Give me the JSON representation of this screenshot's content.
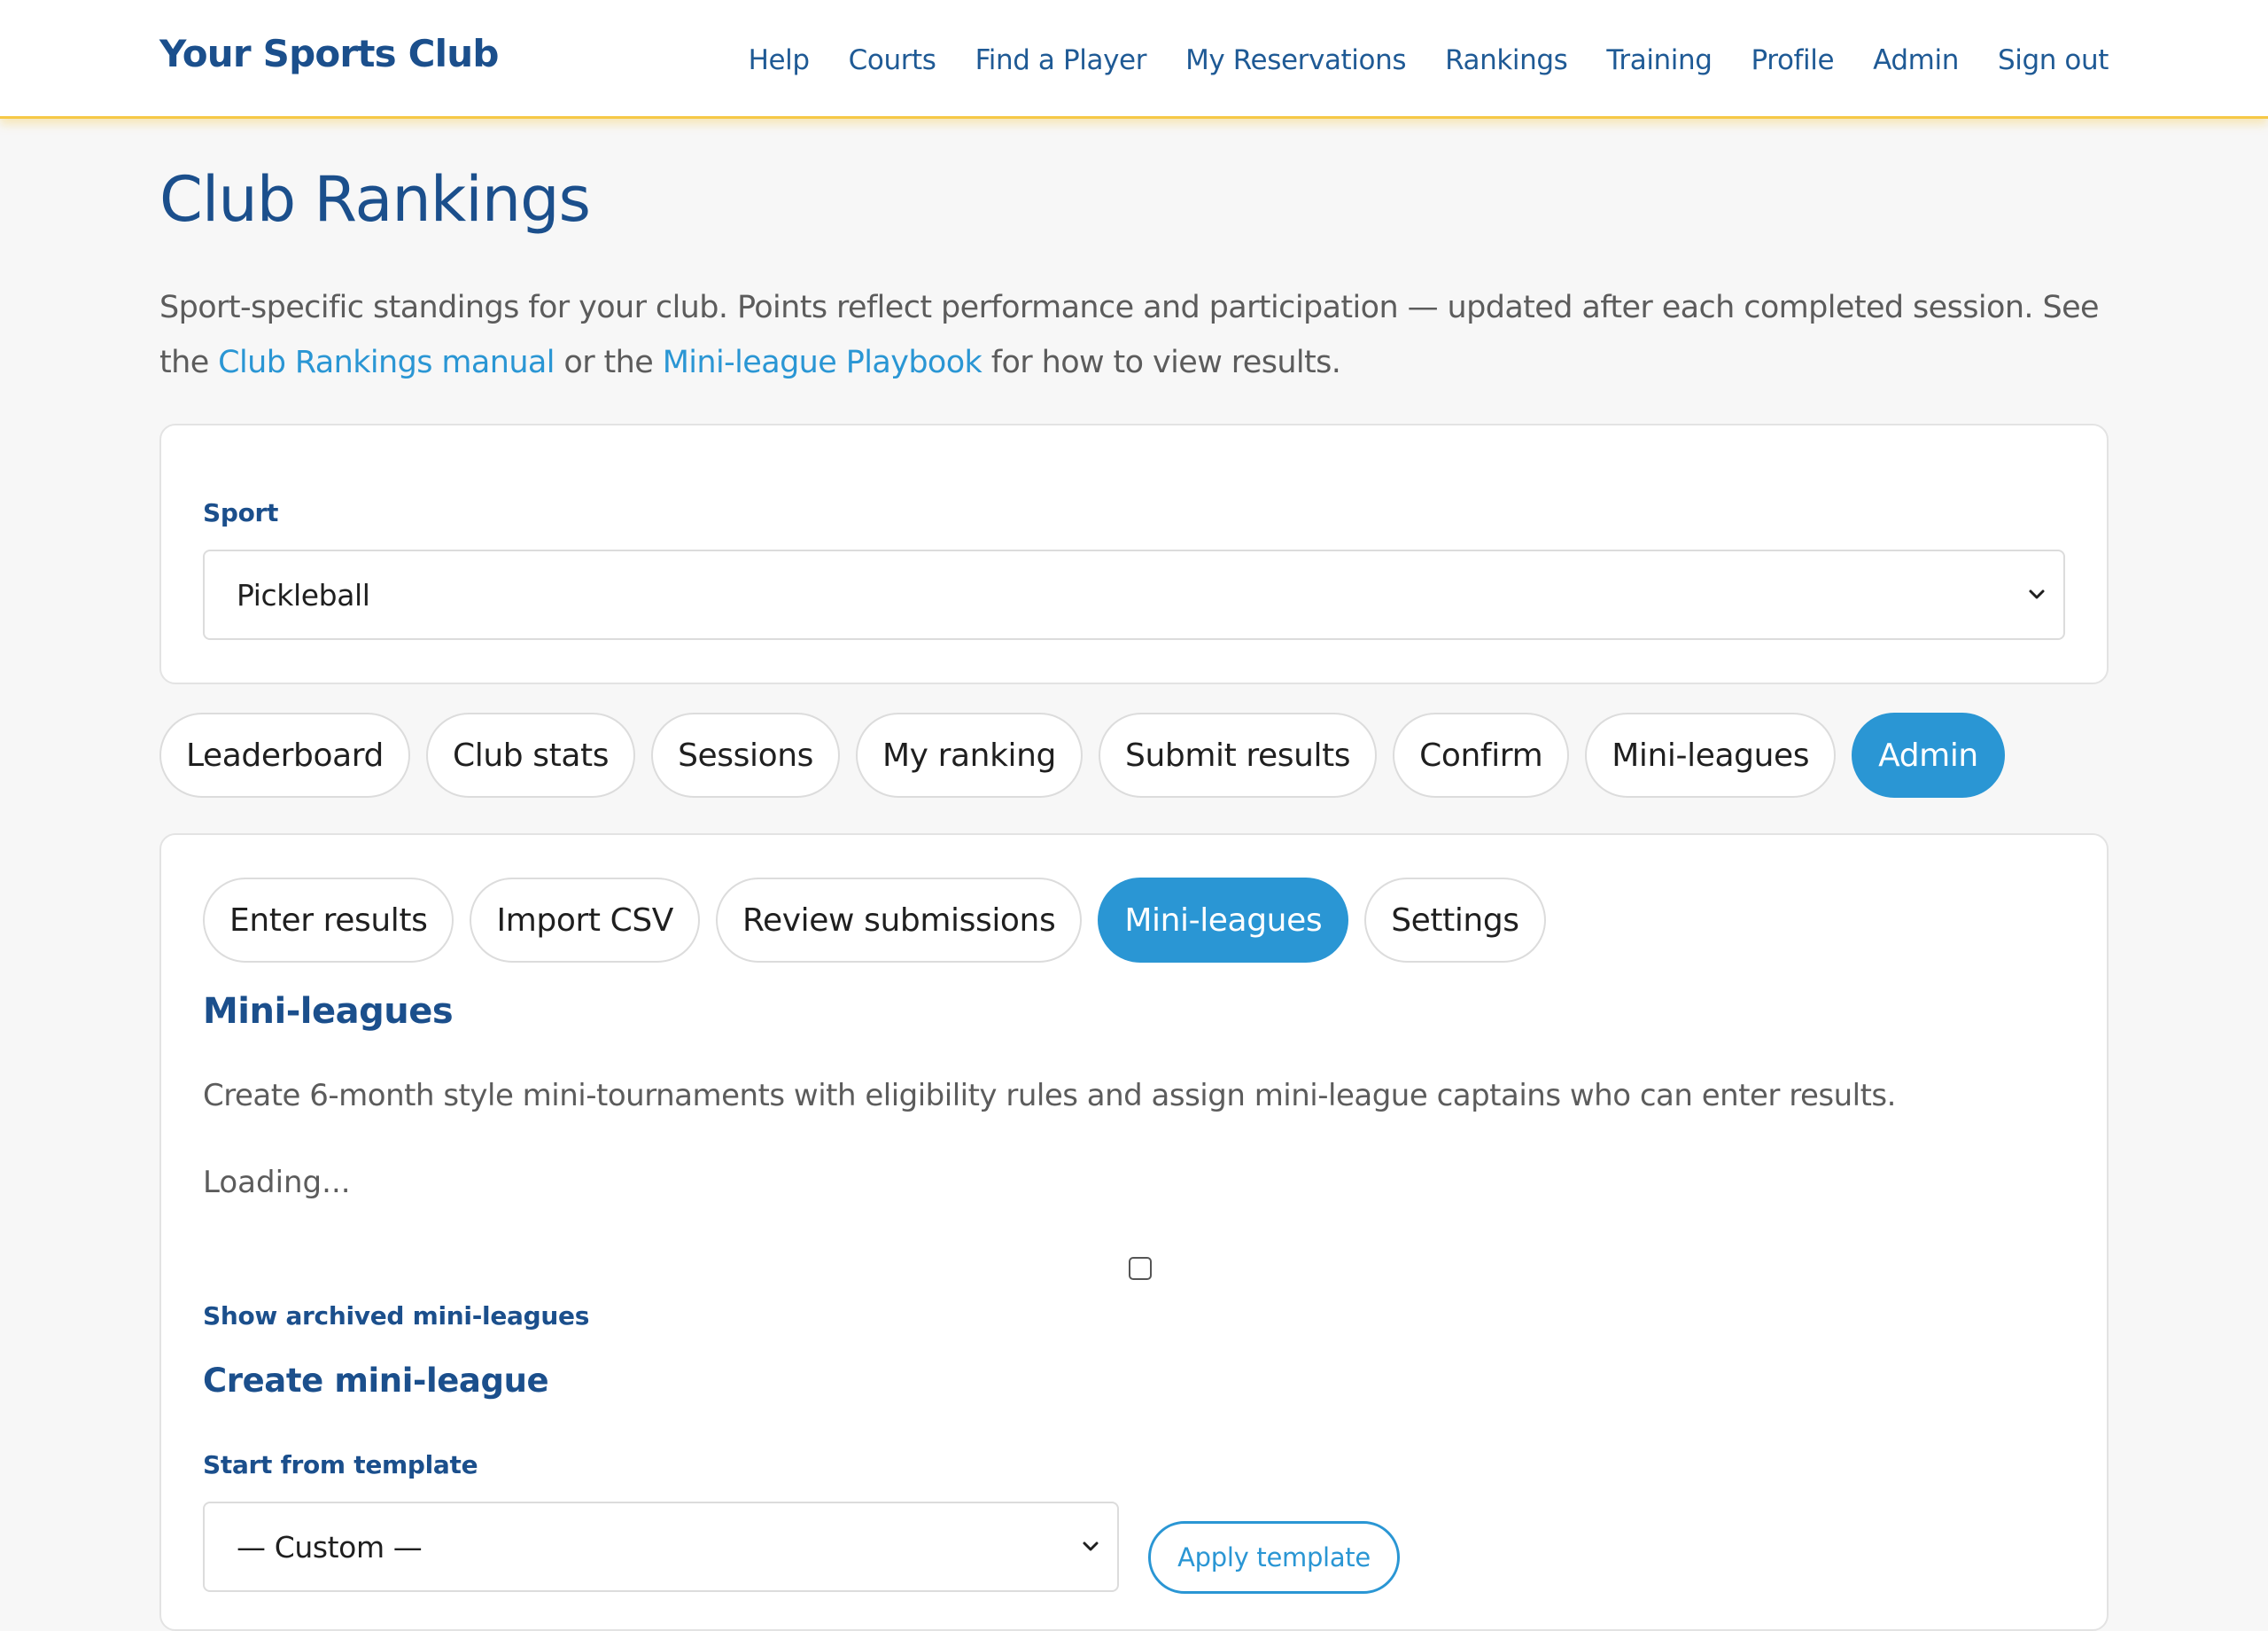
{
  "header": {
    "brand": "Your Sports Club",
    "nav": [
      "Help",
      "Courts",
      "Find a Player",
      "My Reservations",
      "Rankings",
      "Training",
      "Profile",
      "Admin",
      "Sign out"
    ]
  },
  "page": {
    "title": "Club Rankings",
    "intro_text_1": "Sport-specific standings for your club. Points reflect performance and participation — updated after each completed session. See the ",
    "intro_link_1": "Club Rankings manual",
    "intro_text_2": " or the ",
    "intro_link_2": "Mini-league Playbook",
    "intro_text_3": " for how to view results."
  },
  "sport": {
    "label": "Sport",
    "selected": "Pickleball"
  },
  "main_tabs": {
    "items": [
      "Leaderboard",
      "Club stats",
      "Sessions",
      "My ranking",
      "Submit results",
      "Confirm",
      "Mini-leagues",
      "Admin"
    ],
    "active": "Admin"
  },
  "admin_tabs": {
    "items": [
      "Enter results",
      "Import CSV",
      "Review submissions",
      "Mini-leagues",
      "Settings"
    ],
    "active": "Mini-leagues"
  },
  "mini_leagues": {
    "title": "Mini-leagues",
    "description": "Create 6-month style mini-tournaments with eligibility rules and assign mini-league captains who can enter results.",
    "loading": "Loading...",
    "archived_label": "Show archived mini-leagues",
    "archived_checked": false
  },
  "create": {
    "title": "Create mini-league",
    "template_label": "Start from template",
    "template_selected": "— Custom —",
    "apply_button": "Apply template"
  },
  "colors": {
    "brand_blue": "#1b4f8c",
    "accent_blue": "#2a96d4",
    "header_rule": "#f6c846",
    "background": "#f7f7f7"
  }
}
